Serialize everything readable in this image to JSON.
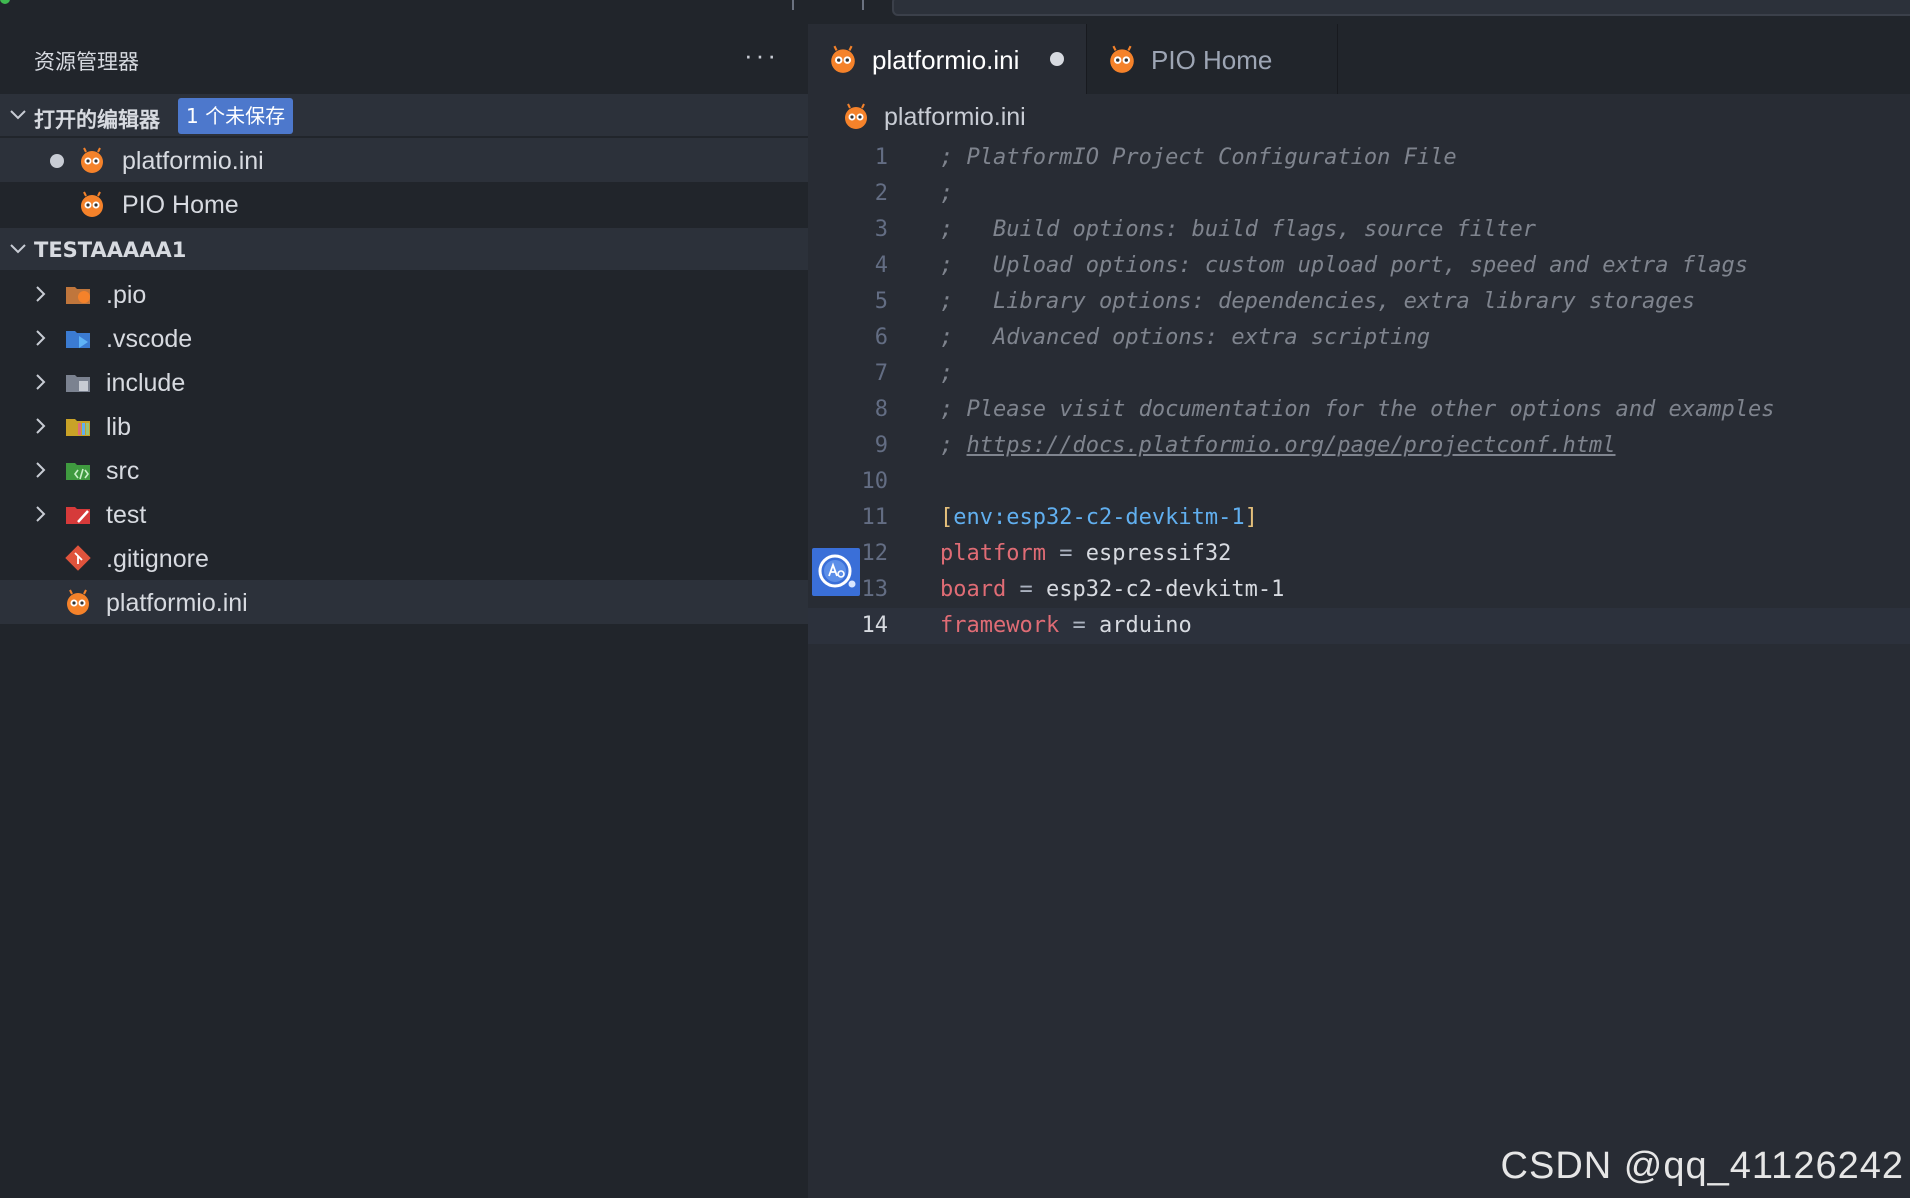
{
  "explorer": {
    "title": "资源管理器",
    "more_label": "···",
    "open_editors": {
      "label": "打开的编辑器",
      "badge": "1 个未保存",
      "items": [
        {
          "label": "platformio.ini",
          "modified": true
        },
        {
          "label": "PIO Home",
          "modified": false
        }
      ]
    },
    "workspace": {
      "label": "TESTAAAAA1",
      "items": [
        {
          "label": ".pio",
          "folder": true,
          "icon": "pio-folder-icon"
        },
        {
          "label": ".vscode",
          "folder": true,
          "icon": "vscode-folder-icon"
        },
        {
          "label": "include",
          "folder": true,
          "icon": "include-folder-icon"
        },
        {
          "label": "lib",
          "folder": true,
          "icon": "lib-folder-icon"
        },
        {
          "label": "src",
          "folder": true,
          "icon": "src-folder-icon"
        },
        {
          "label": "test",
          "folder": true,
          "icon": "test-folder-icon"
        },
        {
          "label": ".gitignore",
          "folder": false,
          "icon": "git-icon"
        },
        {
          "label": "platformio.ini",
          "folder": false,
          "icon": "platformio-icon"
        }
      ]
    }
  },
  "editor": {
    "tabs": [
      {
        "label": "platformio.ini",
        "active": true,
        "modified": true
      },
      {
        "label": "PIO Home",
        "active": false,
        "modified": false
      }
    ],
    "breadcrumb": "platformio.ini",
    "lines": [
      {
        "n": "1",
        "text": "; PlatformIO Project Configuration File"
      },
      {
        "n": "2",
        "text": ";"
      },
      {
        "n": "3",
        "text": ";   Build options: build flags, source filter"
      },
      {
        "n": "4",
        "text": ";   Upload options: custom upload port, speed and extra flags"
      },
      {
        "n": "5",
        "text": ";   Library options: dependencies, extra library storages"
      },
      {
        "n": "6",
        "text": ";   Advanced options: extra scripting"
      },
      {
        "n": "7",
        "text": ";"
      },
      {
        "n": "8",
        "text": "; Please visit documentation for the other options and examples"
      },
      {
        "n": "9",
        "prefix": "; ",
        "url": "https://docs.platformio.org/page/projectconf.html"
      },
      {
        "n": "10",
        "text": ""
      },
      {
        "n": "11",
        "section": "env:esp32-c2-devkitm-1"
      },
      {
        "n": "12",
        "key": "platform",
        "value": "espressif32"
      },
      {
        "n": "13",
        "key": "board",
        "value": "esp32-c2-devkitm-1"
      },
      {
        "n": "14",
        "key": "framework",
        "value": "arduino",
        "current": true
      }
    ],
    "bracket_open": "[",
    "bracket_close": "]",
    "equals": " = "
  },
  "colors": {
    "accent_badge": "#4d78cc",
    "platformio_orange": "#f5822a",
    "comment": "#7f848e",
    "section": "#61afef",
    "key": "#e06c75",
    "bracket": "#e5c07b"
  },
  "watermark": "CSDN @qq_41126242"
}
